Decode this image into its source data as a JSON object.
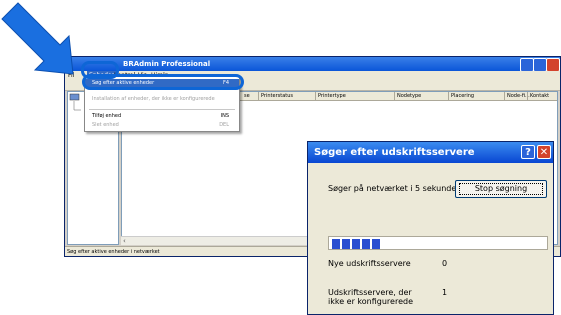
{
  "app": {
    "title": "BRAdmin Professional",
    "menu": {
      "file": "Fil",
      "enheder": "Enheder",
      "kontrol": "Kontrol",
      "vis": "Vis",
      "hjaelp": "Hjælp"
    },
    "columns": [
      "Printerstatus",
      "Printertype",
      "Nodetype",
      "Placering",
      "Node-fi...",
      "Kontakt"
    ],
    "column_partial": "se",
    "status_text": "Søg efter aktive enheder i netværket"
  },
  "dropdown": {
    "items": [
      {
        "label": "Søg efter aktive enheder",
        "shortcut": "F4"
      },
      {
        "label": "Installation af enheder, der ikke er konfigurerede",
        "shortcut": ""
      },
      {
        "label": "Tilføj enhed",
        "shortcut": "INS"
      },
      {
        "label": "Slet enhed",
        "shortcut": "DEL"
      }
    ]
  },
  "dialog": {
    "title": "Søger efter udskriftsservere",
    "help_glyph": "?",
    "close_glyph": "✕",
    "search_text": "Søger på netværket i 5 sekunder.",
    "stop_button": "Stop søgning",
    "progress": {
      "filled_blocks": 5
    },
    "new_servers_label": "Nye udskriftsservere",
    "new_servers_value": "0",
    "unconfigured_label": "Udskriftsservere, der ikke er konfigurerede",
    "unconfigured_value": "1"
  },
  "colors": {
    "highlight": "#0e66d6",
    "titlebar": "#0a55d8",
    "selection": "#316ac5",
    "progress": "#2b4fd0"
  },
  "icons": [
    "arrow-pointer-icon",
    "minimize-icon",
    "maximize-icon",
    "close-icon",
    "help-icon",
    "tree-root-icon"
  ]
}
